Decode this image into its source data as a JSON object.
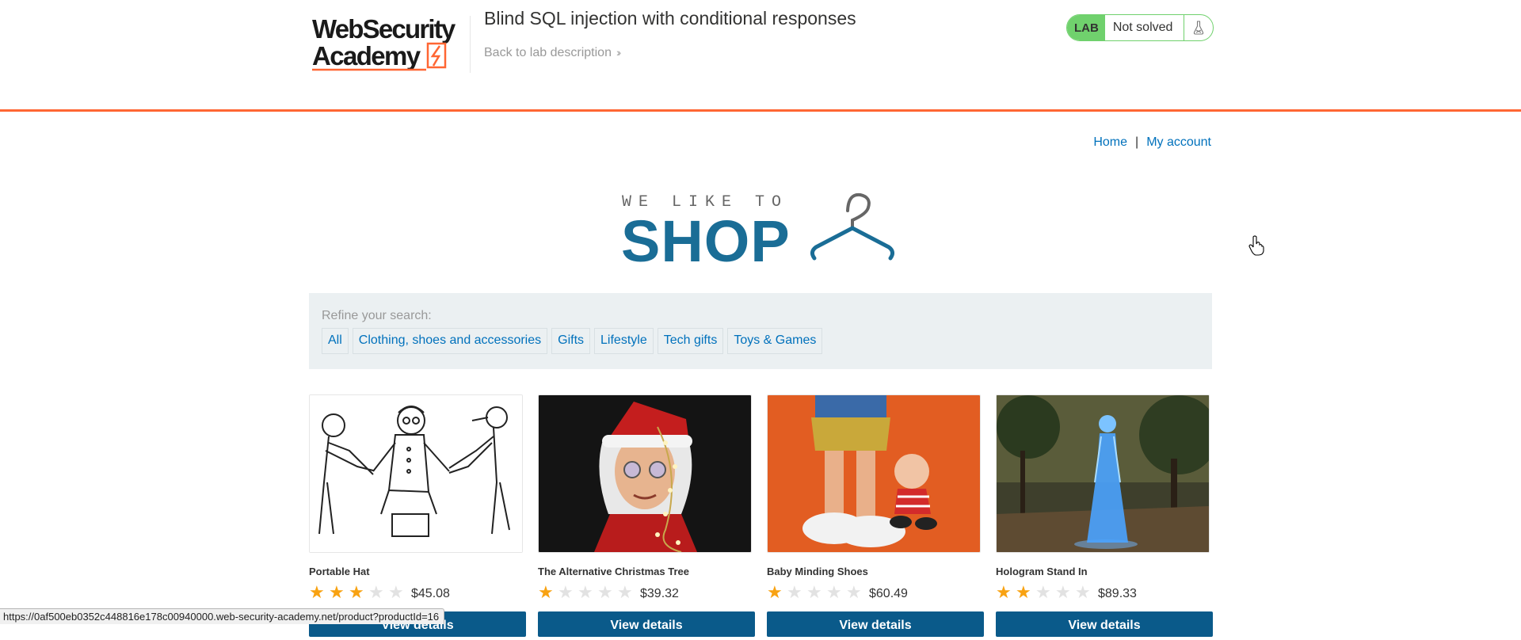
{
  "academy": {
    "logo_text": "Web Security Academy",
    "lab_title": "Blind SQL injection with conditional responses",
    "back_link": "Back to lab description",
    "lab_badge": "LAB",
    "lab_status": "Not solved",
    "accent_color": "#ff6633",
    "badge_color": "#70d16d"
  },
  "nav": {
    "home": "Home",
    "separator": "|",
    "my_account": "My account"
  },
  "shop_logo": {
    "line1": "WE LIKE TO",
    "line2": "SHOP"
  },
  "filter": {
    "label": "Refine your search:",
    "categories": [
      "All",
      "Clothing, shoes and accessories",
      "Gifts",
      "Lifestyle",
      "Tech gifts",
      "Toys & Games"
    ]
  },
  "products": [
    {
      "name": "Portable Hat",
      "rating": 3,
      "price": "$45.08",
      "button": "View details"
    },
    {
      "name": "The Alternative Christmas Tree",
      "rating": 1,
      "price": "$39.32",
      "button": "View details"
    },
    {
      "name": "Baby Minding Shoes",
      "rating": 1,
      "price": "$60.49",
      "button": "View details"
    },
    {
      "name": "Hologram Stand In",
      "rating": 2,
      "price": "$89.33",
      "button": "View details"
    }
  ],
  "status_bar": {
    "url": "https://0af500eb0352c448816e178c00940000.web-security-academy.net/product?productId=16"
  }
}
